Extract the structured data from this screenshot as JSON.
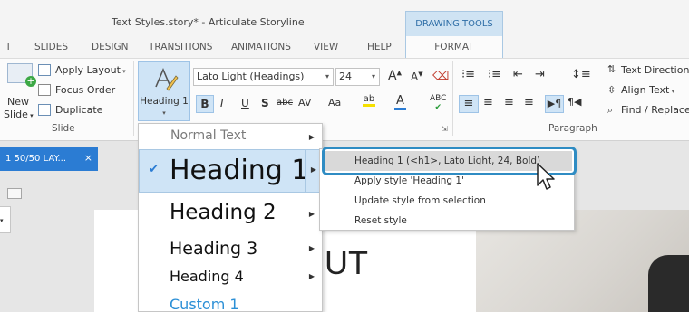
{
  "window": {
    "title": "Text Styles.story* -  Articulate Storyline",
    "context_group": "DRAWING TOOLS"
  },
  "tabs": [
    "T",
    "SLIDES",
    "DESIGN",
    "TRANSITIONS",
    "ANIMATIONS",
    "VIEW",
    "HELP"
  ],
  "active_tab": "FORMAT",
  "ribbon": {
    "slide_group": {
      "new_slide": [
        "New",
        "Slide"
      ],
      "apply_layout": "Apply Layout",
      "focus_order": "Focus Order",
      "duplicate": "Duplicate",
      "label": "Slide"
    },
    "heading_button": [
      "Heading 1"
    ],
    "font_name": "Lato Light (Headings)",
    "font_size": "24",
    "format_buttons": [
      "B",
      "I",
      "U",
      "S",
      "abc",
      "AV",
      "Aa"
    ],
    "paragraph_group": {
      "text_direction": "Text Direction",
      "align_text": "Align Text",
      "find_replace": "Find / Replace",
      "label": "Paragraph"
    }
  },
  "slide_tab": {
    "label": "1 50/50 LAY...",
    "close": "×"
  },
  "canvas": {
    "title_fragment": "UT"
  },
  "style_menu": {
    "items": [
      {
        "label": "Normal Text"
      },
      {
        "label": "Heading 1",
        "checked": true
      },
      {
        "label": "Heading 2"
      },
      {
        "label": "Heading 3"
      },
      {
        "label": "Heading 4"
      },
      {
        "label": "Custom 1"
      }
    ]
  },
  "submenu": {
    "items": [
      "Heading 1 (<h1>, Lato Light, 24, Bold)",
      "Apply style 'Heading 1'",
      "Update style from selection",
      "Reset style"
    ]
  },
  "colors": {
    "accent": "#2b7cd3",
    "highlight": "#cfe4f6",
    "callout": "#2f8cc3",
    "custom_style": "#2b8fd6"
  }
}
